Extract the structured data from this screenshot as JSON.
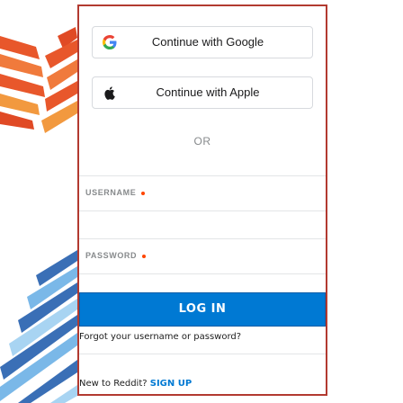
{
  "oauth": {
    "google_label": "Continue with Google",
    "apple_label": "Continue with Apple"
  },
  "divider_text": "OR",
  "form": {
    "username_label": "USERNAME",
    "password_label": "PASSWORD",
    "login_label": "LOG IN",
    "forgot_text": "Forgot your username or password?",
    "signup_prompt": "New to Reddit?",
    "signup_link": "SIGN UP"
  },
  "colors": {
    "accent_blue": "#0079d3",
    "required_dot": "#ff4500",
    "frame_border": "#b23a30",
    "stripe_orange": "#e8572b",
    "stripe_blue": "#3a6fb6"
  },
  "icons": {
    "google": "google-g-icon",
    "apple": "apple-logo-icon",
    "required": "required-dot-icon"
  }
}
